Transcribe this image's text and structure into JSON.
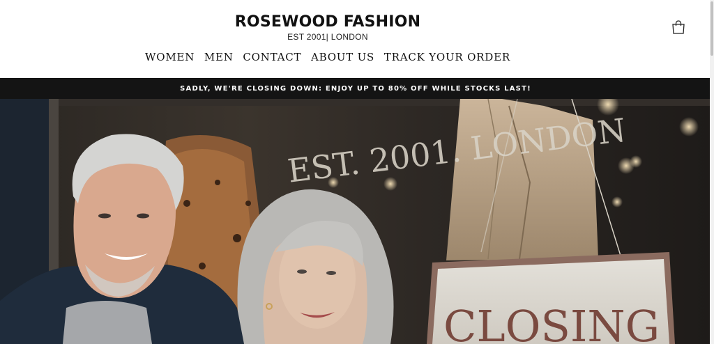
{
  "brand": {
    "title": "ROSEWOOD FASHION",
    "subtitle": "EST 2001| LONDON"
  },
  "header": {
    "cart_icon": "shopping-bag-icon"
  },
  "nav": {
    "items": [
      {
        "label": "WOMEN"
      },
      {
        "label": "MEN"
      },
      {
        "label": "CONTACT"
      },
      {
        "label": "ABOUT US"
      },
      {
        "label": "TRACK YOUR ORDER"
      }
    ]
  },
  "promo": {
    "text": "SADLY, WE'RE CLOSING DOWN: ENJOY UP TO 80% OFF WHILE STOCKS LAST!"
  },
  "hero": {
    "window_text": "EST. 2001. LONDON",
    "sign_text": "CLOSING"
  },
  "colors": {
    "promo_bar": "#141414",
    "sign_text": "#7a4a40",
    "background": "#ffffff"
  }
}
